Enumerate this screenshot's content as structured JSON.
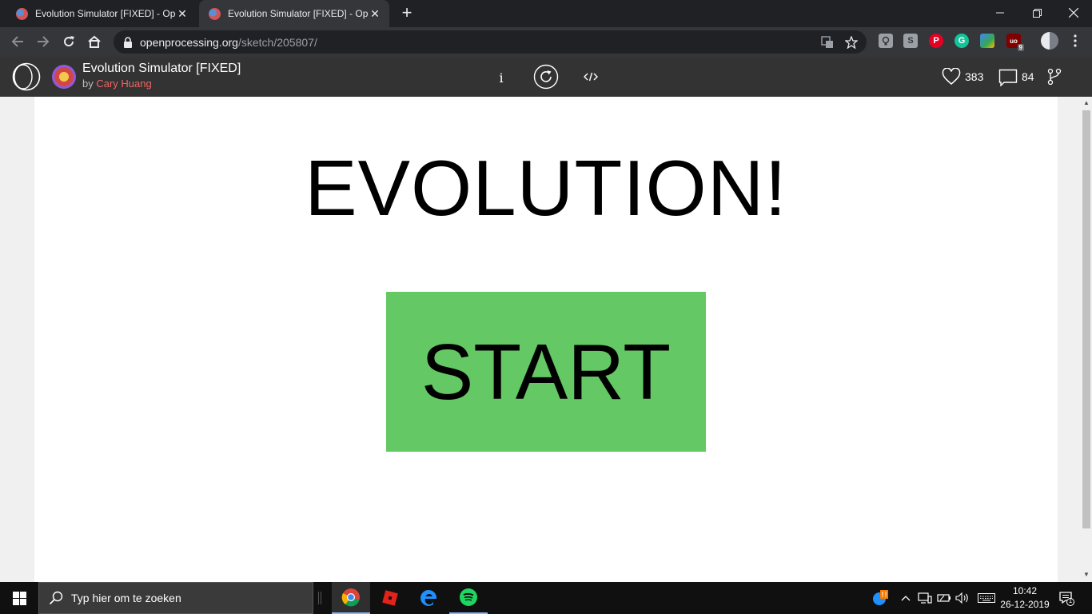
{
  "browser": {
    "tabs": [
      {
        "title": "Evolution Simulator [FIXED] - OpenProcessing",
        "active": false
      },
      {
        "title": "Evolution Simulator [FIXED] - OpenProcessing",
        "active": true
      }
    ],
    "url_host": "openprocessing.org",
    "url_path": "/sketch/205807/",
    "extensions": [
      {
        "name": "keep-extension",
        "label": "",
        "color": "#9aa0a6"
      },
      {
        "name": "s-extension",
        "label": "S",
        "color": "#9aa0a6"
      },
      {
        "name": "pinterest-extension",
        "label": "P",
        "color": "#e60023"
      },
      {
        "name": "grammarly-extension",
        "label": "G",
        "color": "#15c39a"
      },
      {
        "name": "image-extension",
        "label": "",
        "color": "#4285f4"
      },
      {
        "name": "ublock-extension",
        "label": "uo",
        "badge": "9",
        "color": "#800000"
      }
    ]
  },
  "sketch": {
    "title": "Evolution Simulator [FIXED]",
    "by_prefix": "by",
    "author": "Cary Huang",
    "info_label": "i",
    "likes": "383",
    "comments": "84"
  },
  "canvas": {
    "heading": "EVOLUTION!",
    "start_label": "START",
    "button_color": "#64c864"
  },
  "taskbar": {
    "search_placeholder": "Typ hier om te zoeken",
    "time": "10:42",
    "date": "26-12-2019",
    "notification_count": "1"
  }
}
